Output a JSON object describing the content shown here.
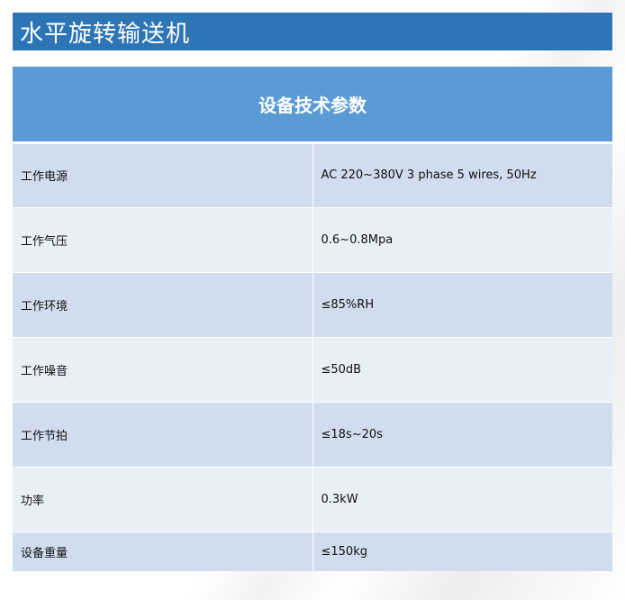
{
  "title": "水平旋转输送机",
  "table": {
    "header": "设备技术参数",
    "rows": [
      {
        "label": "工作电源",
        "value": "AC 220~380V 3 phase 5 wires, 50Hz"
      },
      {
        "label": "工作气压",
        "value": "0.6~0.8Mpa"
      },
      {
        "label": "工作环境",
        "value": "≤85%RH"
      },
      {
        "label": "工作噪音",
        "value": "≤50dB"
      },
      {
        "label": "工作节拍",
        "value": "≤18s~20s"
      },
      {
        "label": "功率",
        "value": "0.3kW"
      },
      {
        "label": "设备重量",
        "value": "≤150kg"
      }
    ]
  },
  "colors": {
    "title_bg": "#2e75b6",
    "header_bg": "#5b9bd5",
    "row_dark": "#d0ddee",
    "row_light": "#e9eff7"
  }
}
